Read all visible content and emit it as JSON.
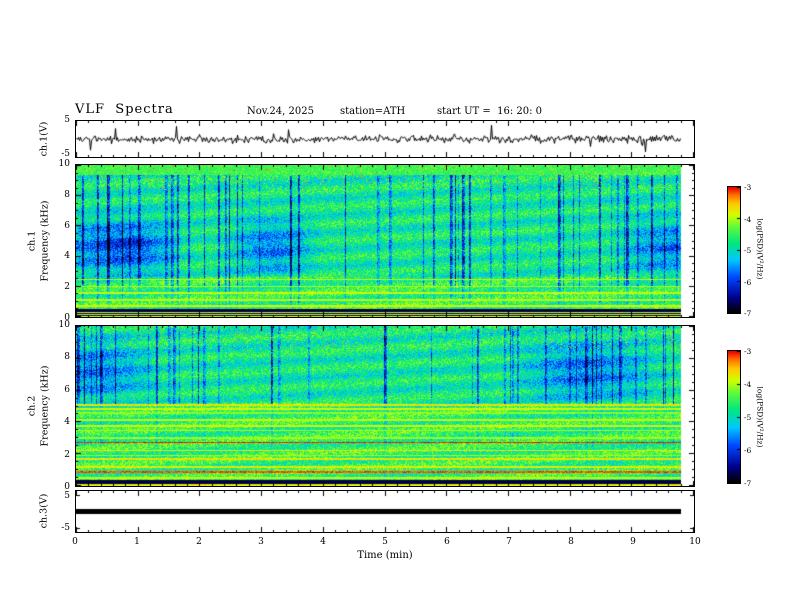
{
  "title": "VLF  Spectra",
  "header": {
    "date": "Nov.24, 2025",
    "station": "station=ATH",
    "start_ut": "start UT =  16: 20: 0"
  },
  "xaxis": {
    "label": "Time (min)",
    "range": [
      0,
      10
    ],
    "ticks": [
      "0",
      "1",
      "2",
      "3",
      "4",
      "5",
      "6",
      "7",
      "8",
      "9",
      "10"
    ],
    "data_end_min": 9.8
  },
  "panels": {
    "waveform": {
      "ylabel": "ch.1(V)",
      "ylim": [
        -5,
        5
      ],
      "ytick_top": "5",
      "ytick_bottom": "-5"
    },
    "spec1": {
      "ylabel_channel": "ch.1",
      "ylabel_axis": "Frequency (kHz)",
      "ylim": [
        0,
        10
      ],
      "yticks": [
        "10",
        "8",
        "6",
        "4",
        "2",
        "0"
      ]
    },
    "spec2": {
      "ylabel_channel": "ch.2",
      "ylabel_axis": "Frequency (kHz)",
      "ylim": [
        0,
        10
      ],
      "yticks": [
        "10",
        "8",
        "6",
        "4",
        "2",
        "0"
      ]
    },
    "ch3": {
      "ylabel": "ch.3(V)",
      "ylim": [
        -5,
        5
      ],
      "ytick_top": "5",
      "ytick_bottom": "-5",
      "flat_value": 0
    }
  },
  "colorbar": {
    "label": "log(PSD)(V²/Hz)",
    "ticks": [
      "-3",
      "-4",
      "-5",
      "-6",
      "-7"
    ],
    "range": [
      -7,
      -3
    ],
    "palette": [
      [
        0.0,
        "#000000"
      ],
      [
        0.12,
        "#00008c"
      ],
      [
        0.28,
        "#0046ff"
      ],
      [
        0.42,
        "#00c8ff"
      ],
      [
        0.55,
        "#00e682"
      ],
      [
        0.68,
        "#5afa3c"
      ],
      [
        0.78,
        "#d2ff00"
      ],
      [
        0.87,
        "#ffc800"
      ],
      [
        0.94,
        "#ff6e00"
      ],
      [
        1.0,
        "#eb0000"
      ]
    ]
  },
  "colors": {
    "background": "#ffffff",
    "axis": "#000000",
    "trace": "#000000"
  },
  "chart_data": [
    {
      "type": "line",
      "name": "ch.1 voltage waveform",
      "xlabel": "Time (min)",
      "xlim": [
        0,
        10
      ],
      "ylabel": "ch.1(V)",
      "ylim": [
        -5,
        5
      ],
      "x_extent": [
        0,
        9.8
      ],
      "description": "broadband noise around 0 V with frequent impulsive sferic spikes reaching about ±4 V"
    },
    {
      "type": "heatmap",
      "name": "ch.1 VLF spectrogram",
      "xlabel": "Time (min)",
      "xlim": [
        0,
        10
      ],
      "ylabel": "Frequency (kHz)",
      "ylim": [
        0,
        10
      ],
      "zlabel": "log(PSD)(V²/Hz)",
      "zlim": [
        -7,
        -3
      ],
      "x_extent": [
        0,
        9.8
      ],
      "description": "green/cyan background near -5; dense vertical dark-blue sferic streaks spanning 1-10 kHz; broad blue patches near 3-6 kHz; red/orange speckle above 8.5 kHz; bright horizontal hum lines below 2.5 kHz; black band near 0.4 kHz and striped rows at the very bottom"
    },
    {
      "type": "heatmap",
      "name": "ch.2 VLF spectrogram",
      "xlabel": "Time (min)",
      "xlim": [
        0,
        10
      ],
      "ylabel": "Frequency (kHz)",
      "ylim": [
        0,
        10
      ],
      "zlabel": "log(PSD)(V²/Hz)",
      "zlim": [
        -7,
        -3
      ],
      "x_extent": [
        0,
        9.8
      ],
      "description": "vertical blue streaks mostly above 5 kHz; many continuous yellow-to-red horizontal interference lines between 0.3 and 5 kHz on a green background; black band near 0.2 kHz"
    },
    {
      "type": "line",
      "name": "ch.3 voltage waveform",
      "xlabel": "Time (min)",
      "xlim": [
        0,
        10
      ],
      "ylabel": "ch.3(V)",
      "ylim": [
        -5,
        5
      ],
      "x_extent": [
        0,
        9.8
      ],
      "values": [
        0,
        0
      ],
      "description": "constant 0 V flat thick black trace across the whole record"
    }
  ]
}
